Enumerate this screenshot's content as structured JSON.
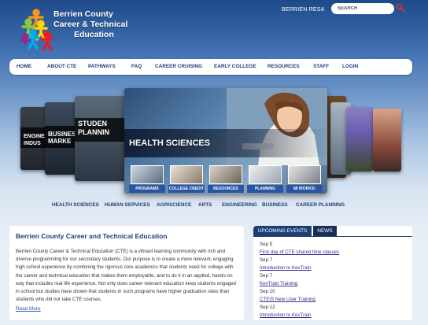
{
  "header": {
    "logo_line1": "Berrien County",
    "logo_line2": "Career & Technical",
    "logo_line3": "Education",
    "resa_link": "BERRIEN RESA",
    "search_placeholder": "SEARCH"
  },
  "nav": {
    "items": [
      "HOME",
      "ABOUT CTE",
      "PATHWAYS",
      "FAQ",
      "CAREER CRUISING",
      "EARLY COLLEGE",
      "RESOURCES",
      "STAFF",
      "LOGIN"
    ]
  },
  "carousel": {
    "side_cards": [
      "ENGINEE & INDUS",
      "BUSINES & MARKE",
      "STUDEN PLANNIN"
    ],
    "main_title": "HEALTH SCIENCES",
    "thumbs": [
      "PROGRAMS",
      "COLLEGE CREDIT",
      "RESOURCES",
      "PLANNING",
      "MI WORKS!"
    ]
  },
  "subnav": {
    "items": [
      "HEALTH SCIENCES",
      "HUMAN SERVICES",
      "AGRISCIENCE",
      "ARTS",
      "ENGINEERING",
      "BUSINESS",
      "CAREER PLANNING"
    ]
  },
  "intro": {
    "title": "Berrien County Career and Technical Education",
    "body": "Berrien County Career & Technical Education (CTE) is a vibrant learning community with rich and diverse programming for our secondary students. Our purpose is to create a more relevant, engaging high school experience by combining the rigorous core academics that students need for college with the career and technical education that makes them employable, and to do it in an applied, hands-on way that includes real life experience. Not only does career relevant education keep students engaged in school but studies have shown that students in such programs have higher graduation rates than students who did not take CTE courses.",
    "read_more": "Read More"
  },
  "events": {
    "tab_upcoming": "UPCOMING EVENTS",
    "tab_news": "NEWS",
    "items": [
      {
        "date": "Sep 5",
        "title": "First day of CTE shared time classes"
      },
      {
        "date": "Sep 7",
        "title": "Introduction to KevTrain"
      },
      {
        "date": "Sep 7",
        "title": "KevTrain Training"
      },
      {
        "date": "Sep 10",
        "title": "CTEIS New User Training"
      },
      {
        "date": "Sep 12",
        "title": "Introduction to KevTrain"
      }
    ]
  }
}
